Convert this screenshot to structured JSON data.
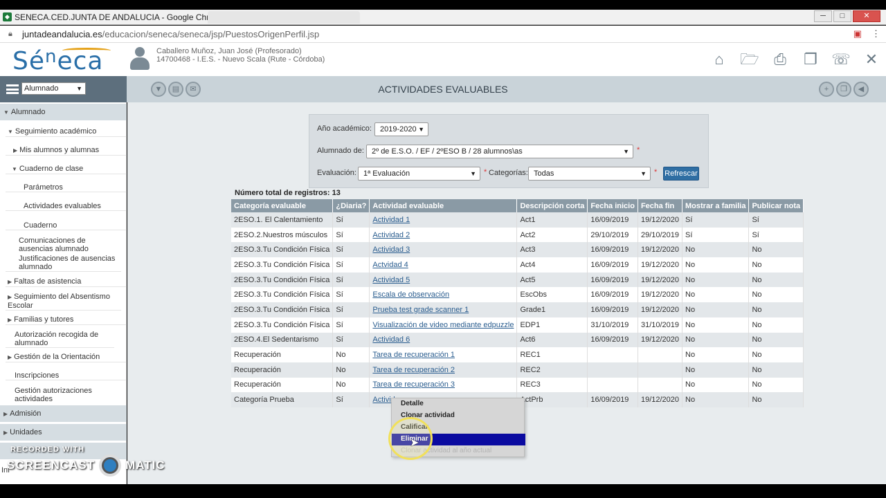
{
  "browser": {
    "window_title": "SENECA.CED.JUNTA DE ANDALUCIA - Google Chrome",
    "url_host": "juntadeandalucia.es",
    "url_path": "/educacion/seneca/seneca/jsp/PuestosOrigenPerfil.jsp",
    "minimize": "─",
    "maximize": "□",
    "close": "✕"
  },
  "header": {
    "logo_pre": "Sé",
    "logo_n": "n",
    "logo_post": "eca",
    "user_name": "Caballero Muñoz, Juan José (Profesorado)",
    "user_center": "14700468 - I.E.S. - Nuevo Scala (Rute - Córdoba)",
    "icons": [
      "home-icon",
      "folder-icon",
      "print-icon",
      "documents-icon",
      "phone-icon",
      "close-icon"
    ]
  },
  "toolbar": {
    "profile": "Alumnado",
    "title": "ACTIVIDADES EVALUABLES"
  },
  "sidebar": [
    {
      "label": "Alumnado"
    },
    {
      "label": "Seguimiento académico"
    },
    {
      "label": "Mis alumnos y alumnas"
    },
    {
      "label": "Cuaderno de clase"
    },
    {
      "label": "Parámetros"
    },
    {
      "label": "Actividades evaluables"
    },
    {
      "label": "Cuaderno"
    },
    {
      "label": "Comunicaciones de ausencias alumnado"
    },
    {
      "label": "Justificaciones de ausencias alumnado"
    },
    {
      "label": "Faltas de asistencia"
    },
    {
      "label": "Seguimiento del Absentismo Escolar"
    },
    {
      "label": "Familias y tutores"
    },
    {
      "label": "Autorización recogida de alumnado"
    },
    {
      "label": "Gestión de la Orientación"
    },
    {
      "label": "Inscripciones"
    },
    {
      "label": "Gestión autorizaciones actividades"
    },
    {
      "label": "Admisión"
    },
    {
      "label": "Unidades"
    },
    {
      "label": "Inf"
    }
  ],
  "filters": {
    "year_label": "Año académico:",
    "year_value": "2019-2020",
    "students_label": "Alumnado de:",
    "students_value": "2º de E.S.O. / EF / 2ºESO B / 28 alumnos\\as",
    "eval_label": "Evaluación:",
    "eval_value": "1ª Evaluación",
    "cat_label": "Categorías:",
    "cat_value": "Todas",
    "required": "*",
    "refresh": "Refrescar"
  },
  "table": {
    "total": "Número total de registros: 13",
    "columns": [
      "Categoría evaluable",
      "¿Diaria?",
      "Actividad evaluable",
      "Descripción corta",
      "Fecha inicio",
      "Fecha fin",
      "Mostrar a familia",
      "Publicar nota"
    ],
    "rows": [
      [
        "2ESO.1. El Calentamiento",
        "Sí",
        "Actividad 1",
        "Act1",
        "16/09/2019",
        "19/12/2020",
        "Sí",
        "Sí"
      ],
      [
        "2ESO.2.Nuestros músculos",
        "Sí",
        "Actividad 2",
        "Act2",
        "29/10/2019",
        "29/10/2019",
        "Sí",
        "Sí"
      ],
      [
        "2ESO.3.Tu Condición Física",
        "Sí",
        "Actividad 3",
        "Act3",
        "16/09/2019",
        "19/12/2020",
        "No",
        "No"
      ],
      [
        "2ESO.3.Tu Condición Física",
        "Sí",
        "Actvidad 4",
        "Act4",
        "16/09/2019",
        "19/12/2020",
        "No",
        "No"
      ],
      [
        "2ESO.3.Tu Condición Física",
        "Sí",
        "Actividad 5",
        "Act5",
        "16/09/2019",
        "19/12/2020",
        "No",
        "No"
      ],
      [
        "2ESO.3.Tu Condición Física",
        "Sí",
        "Escala de observación",
        "EscObs",
        "16/09/2019",
        "19/12/2020",
        "No",
        "No"
      ],
      [
        "2ESO.3.Tu Condición Física",
        "Sí",
        "Prueba test grade scanner 1",
        "Grade1",
        "16/09/2019",
        "19/12/2020",
        "No",
        "No"
      ],
      [
        "2ESO.3.Tu Condición Física",
        "Sí",
        "Visualización de video mediante edpuzzle",
        "EDP1",
        "31/10/2019",
        "31/10/2019",
        "No",
        "No"
      ],
      [
        "2ESO.4.El Sedentarismo",
        "Sí",
        "Actividad 6",
        "Act6",
        "16/09/2019",
        "19/12/2020",
        "No",
        "No"
      ],
      [
        "Recuperación",
        "No",
        "Tarea de recuperación 1",
        "REC1",
        "",
        "",
        "No",
        "No"
      ],
      [
        "Recuperación",
        "No",
        "Tarea de recuperación 2",
        "REC2",
        "",
        "",
        "No",
        "No"
      ],
      [
        "Recuperación",
        "No",
        "Tarea de recuperación 3",
        "REC3",
        "",
        "",
        "No",
        "No"
      ],
      [
        "Categoría Prueba",
        "Sí",
        "Activid",
        "ActPrb",
        "16/09/2019",
        "19/12/2020",
        "No",
        "No"
      ]
    ]
  },
  "context_menu": {
    "items": [
      "Detalle",
      "Clonar actividad",
      "Calificar",
      "Eliminar",
      "Clonar actividad al año actual"
    ],
    "active": "Eliminar"
  },
  "watermark": {
    "recorded": "RECORDED WITH",
    "brand_left": "SCREENCAST",
    "brand_right": "MATIC"
  }
}
